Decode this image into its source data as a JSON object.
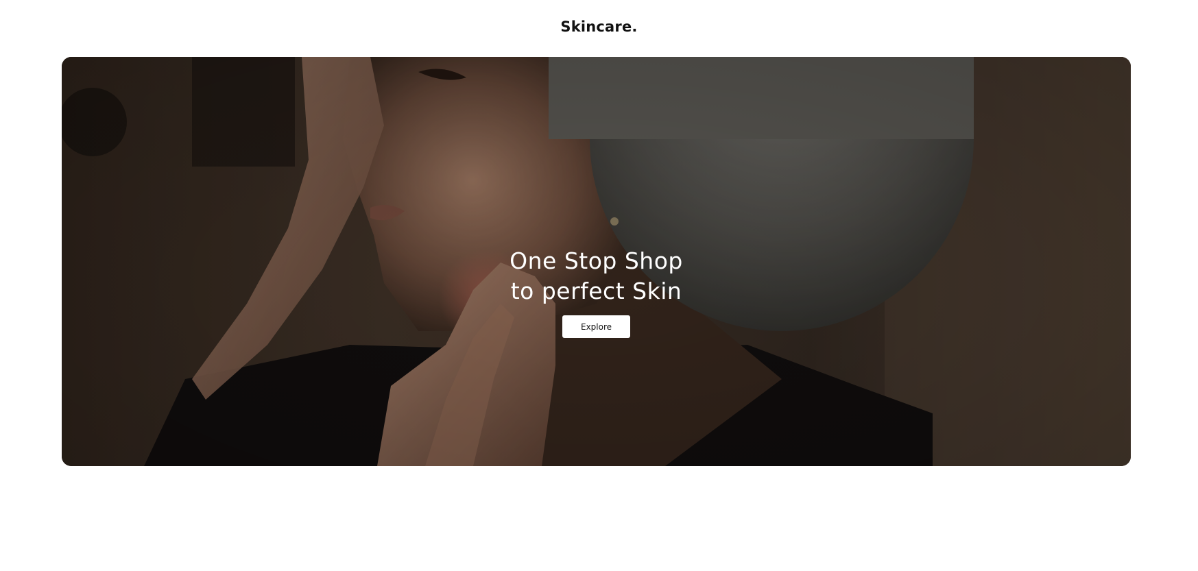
{
  "header": {
    "brand": "Skincare."
  },
  "hero": {
    "headline_line1": "One Stop Shop",
    "headline_line2": "to perfect Skin",
    "cta_label": "Explore",
    "image_subject": "woman-with-towel-wrap-applying-skincare"
  },
  "colors": {
    "page_background": "#ffffff",
    "brand_text": "#111111",
    "hero_text": "#ffffff",
    "button_background": "#ffffff",
    "button_text": "#111111"
  }
}
